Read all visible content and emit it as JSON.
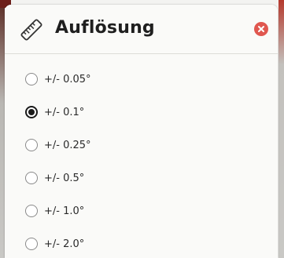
{
  "dialog": {
    "title": "Auflösung",
    "header_icon": "ruler-icon",
    "close_icon": "close-icon",
    "close_color": "#e0574f"
  },
  "options": [
    {
      "label": "+/- 0.05°",
      "checked": false
    },
    {
      "label": "+/- 0.1°",
      "checked": true
    },
    {
      "label": "+/- 0.25°",
      "checked": false
    },
    {
      "label": "+/- 0.5°",
      "checked": false
    },
    {
      "label": "+/- 1.0°",
      "checked": false
    },
    {
      "label": "+/- 2.0°",
      "checked": false
    }
  ]
}
